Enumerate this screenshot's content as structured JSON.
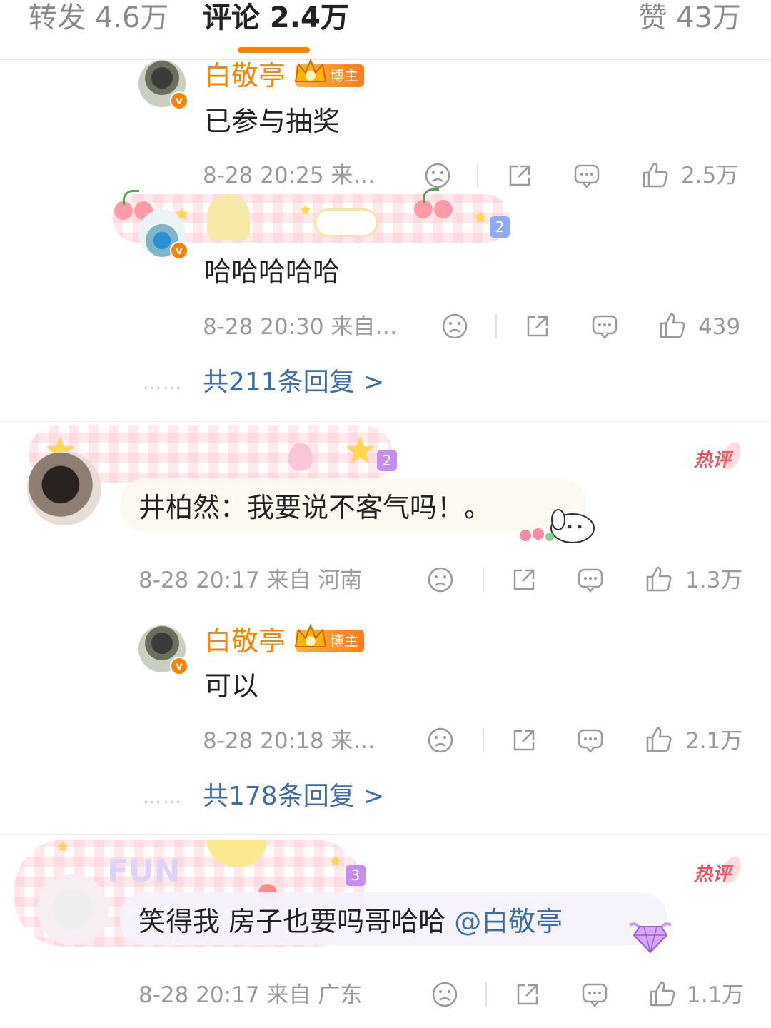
{
  "tabs": {
    "repost": "转发 4.6万",
    "comment": "评论 2.4万",
    "like": "赞 43万"
  },
  "colors": {
    "accent": "#ff8200",
    "link": "#3f6da8",
    "hot": "#f0525d",
    "meta": "#9a9a9a"
  },
  "thread1": {
    "reply1": {
      "name": "白敬亭",
      "badge": "博主",
      "text": "已参与抽奖",
      "meta": "8-28 20:25 来…",
      "likes": "2.5万"
    },
    "reply2": {
      "text": "哈哈哈哈哈",
      "meta": "8-28 20:30 来自…",
      "likes": "439",
      "level": "2"
    },
    "more": "共211条回复 >"
  },
  "comment2": {
    "hot": "热评",
    "level": "2",
    "text": "井柏然：我要说不客气吗！。",
    "meta": "8-28 20:17 来自 河南",
    "likes": "1.3万",
    "reply": {
      "name": "白敬亭",
      "badge": "博主",
      "text": "可以",
      "meta": "8-28 20:18 来…",
      "likes": "2.1万"
    },
    "more": "共178条回复 >"
  },
  "comment3": {
    "hot": "热评",
    "level": "3",
    "text": "笑得我 房子也要吗哥哈哈",
    "mention": "@白敬亭",
    "meta": "8-28 20:17 来自 广东",
    "likes": "1.1万"
  },
  "icons": [
    "frown-icon",
    "share-icon",
    "comment-icon",
    "thumb-up-icon",
    "verified-icon",
    "crown-icon"
  ]
}
